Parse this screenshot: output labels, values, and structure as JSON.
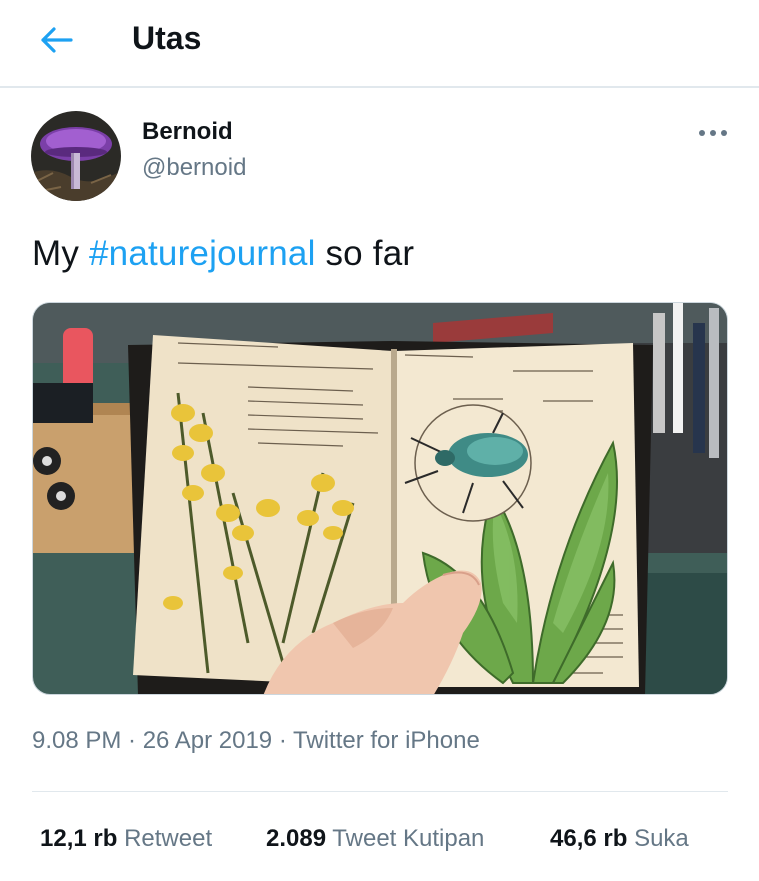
{
  "header": {
    "title": "Utas",
    "accent": "#1da1f2"
  },
  "tweet": {
    "author_name": "Bernoid",
    "author_handle": "@bernoid",
    "text_before": "My ",
    "hashtag": "#naturejournal",
    "text_after": " so far",
    "timestamp": "9.08 PM · 26 Apr 2019 · Twitter for iPhone"
  },
  "stats": {
    "retweets_count": "12,1 rb",
    "retweets_label": "Retweet",
    "quotes_count": "2.089",
    "quotes_label": "Tweet Kutipan",
    "likes_count": "46,6 rb",
    "likes_label": "Suka"
  },
  "icons": {
    "back": "back-arrow-icon",
    "more": "more-options-icon"
  }
}
